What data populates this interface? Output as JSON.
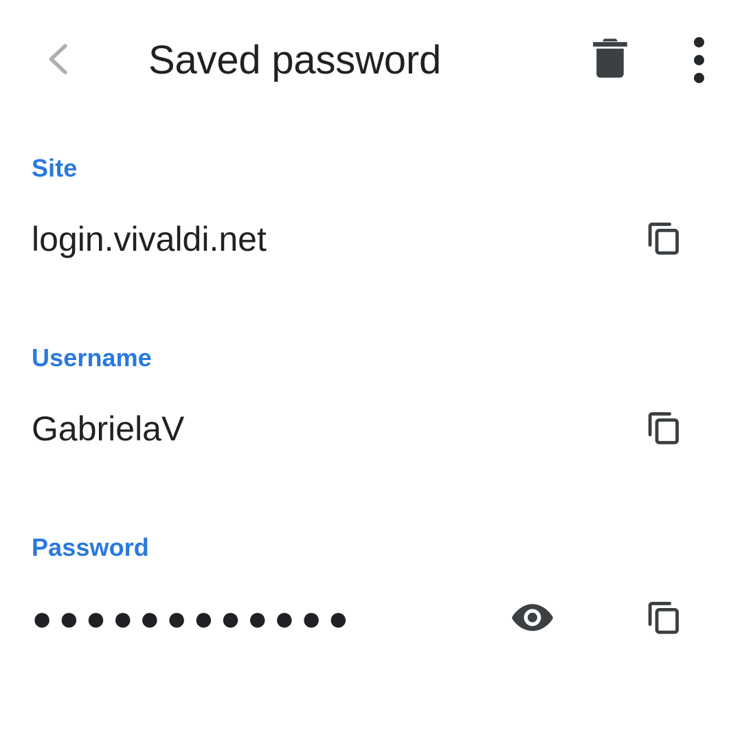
{
  "app": {
    "background_color": "#FFFFFF",
    "accent_color": "#2979DE",
    "text_color": "#202124",
    "icon_color": "#3C4043",
    "back_icon_color": "#AAAAAA"
  },
  "header": {
    "title": "Saved password",
    "back_icon": "chevron-left-icon",
    "delete_icon": "trash-icon",
    "overflow_icon": "more-vertical-icon"
  },
  "fields": [
    {
      "label": "Site",
      "value": "login.vivaldi.net",
      "masked": false,
      "copy_icon": "copy-icon",
      "has_reveal": false
    },
    {
      "label": "Username",
      "value": "GabrielaV",
      "masked": false,
      "copy_icon": "copy-icon",
      "has_reveal": false
    },
    {
      "label": "Password",
      "value": "●●●●●●●●●●●●",
      "masked": true,
      "mask_character_count": 12,
      "copy_icon": "copy-icon",
      "has_reveal": true,
      "reveal_icon": "eye-icon"
    }
  ]
}
